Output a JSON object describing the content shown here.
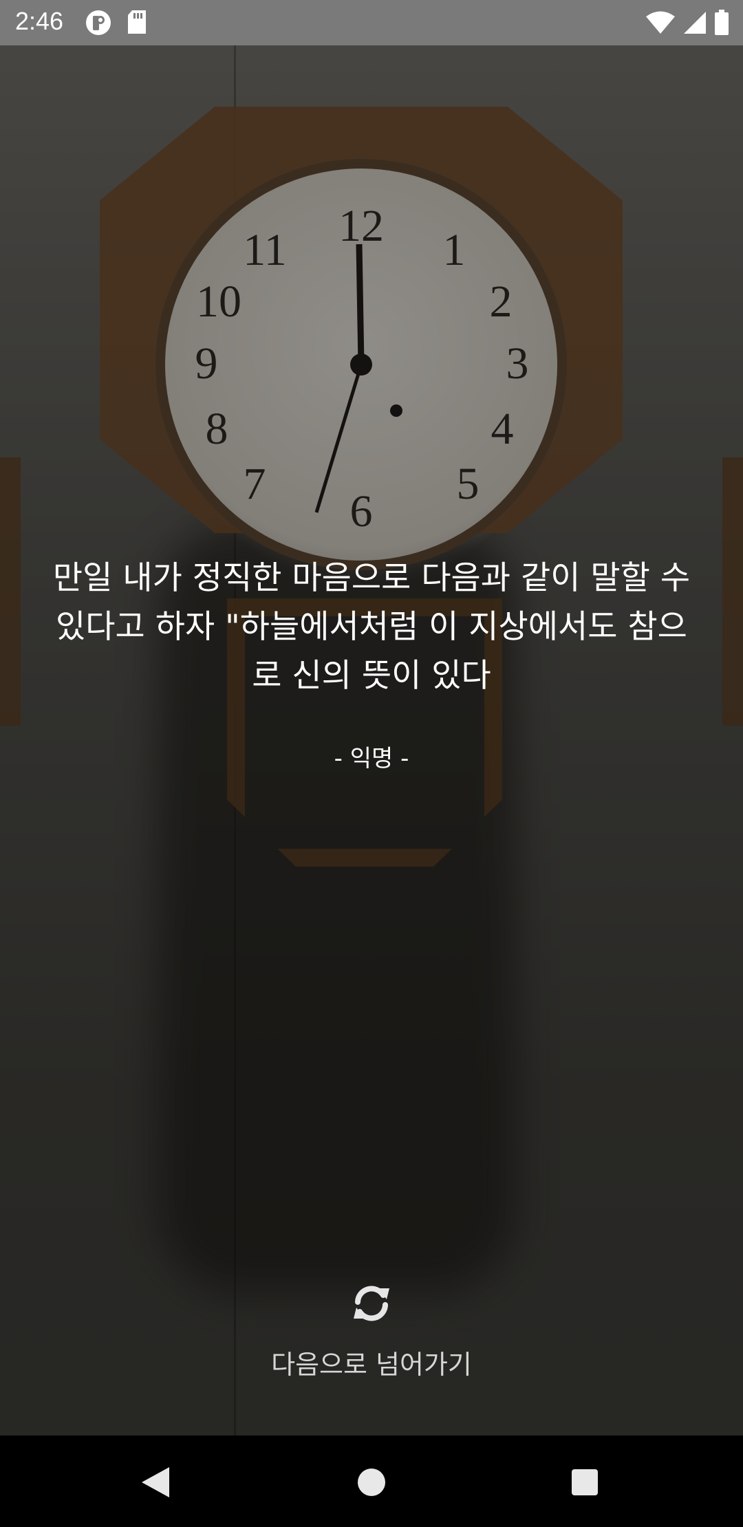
{
  "status_bar": {
    "time": "2:46",
    "left_icons": [
      "pocket-icon",
      "sd-card-icon"
    ],
    "right_icons": [
      "wifi-icon",
      "signal-icon",
      "battery-icon"
    ]
  },
  "quote": {
    "text": "만일 내가 정직한 마음으로 다음과 같이 말할 수 있다고 하자 \"하늘에서처럼 이 지상에서도 참으로 신의 뜻이 있다",
    "author": "- 익명 -"
  },
  "actions": {
    "next_label": "다음으로 넘어가기",
    "refresh_icon": "refresh-icon"
  },
  "nav_bar": {
    "back_icon": "back-icon",
    "home_icon": "home-icon",
    "recents_icon": "recents-icon"
  },
  "colors": {
    "status_bar_bg": "#7a7a7a",
    "text": "#ffffff",
    "nav_bar_bg": "#000000"
  }
}
